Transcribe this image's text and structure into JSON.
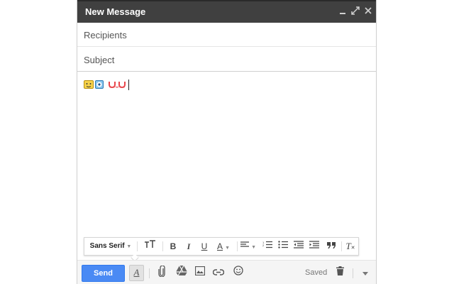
{
  "window": {
    "title": "New Message",
    "controls": {
      "minimize_icon": "minimize-icon",
      "popout_icon": "popout-icon",
      "close_icon": "close-icon"
    }
  },
  "fields": {
    "recipients_placeholder": "Recipients",
    "subject_placeholder": "Subject"
  },
  "body": {
    "emojis": [
      "yellow-face-emoji",
      "blue-face-emoji",
      "pink-uu-emoticon"
    ]
  },
  "format_toolbar": {
    "font_label": "Sans Serif",
    "bold_label": "B",
    "italic_label": "I",
    "underline_label": "U",
    "text_color_label": "A",
    "remove_format_label": "T",
    "icons": [
      "font-size-icon",
      "bold-icon",
      "italic-icon",
      "underline-icon",
      "text-color-icon",
      "align-icon",
      "numbered-list-icon",
      "bulleted-list-icon",
      "indent-less-icon",
      "indent-more-icon",
      "quote-icon",
      "remove-formatting-icon"
    ]
  },
  "bottom_bar": {
    "send_label": "Send",
    "formatting_toggle_label": "A",
    "saved_label": "Saved",
    "icons": [
      "attach-icon",
      "drive-icon",
      "photo-icon",
      "link-icon",
      "emoji-icon",
      "trash-icon",
      "more-options-icon"
    ]
  },
  "colors": {
    "title_bar": "#404040",
    "send_button": "#4a8af4",
    "emoticon_pink": "#e8454a"
  }
}
